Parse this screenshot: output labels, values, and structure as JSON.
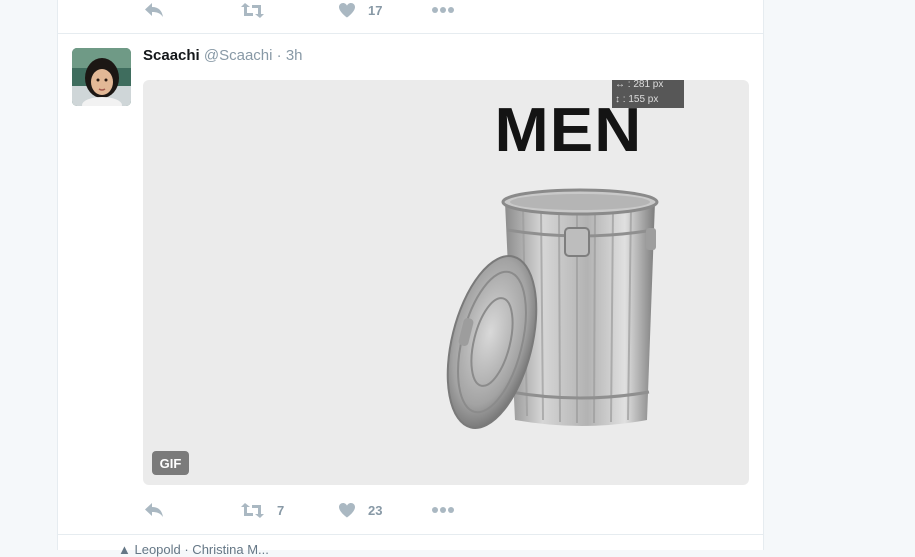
{
  "previous_tweet": {
    "like_count": "17"
  },
  "tweet": {
    "display_name": "Scaachi",
    "handle": "@Scaachi",
    "separator": "·",
    "timestamp": "3h",
    "media": {
      "type_badge": "GIF",
      "image_text": "MEN",
      "overlay_lines": [
        "↔ : 281 px",
        "↕ : 155 px"
      ]
    },
    "actions": {
      "retweet_count": "7",
      "like_count": "23"
    }
  },
  "next_tweet_partial": "▲ Leopold · Christina M...",
  "icons": [
    "reply-icon",
    "retweet-icon",
    "heart-icon",
    "more-icon"
  ],
  "colors": {
    "icon": "#aab8c2",
    "count_text": "#8899a6",
    "name_text": "#14171a",
    "feed_bg": "#f5f8fa"
  }
}
